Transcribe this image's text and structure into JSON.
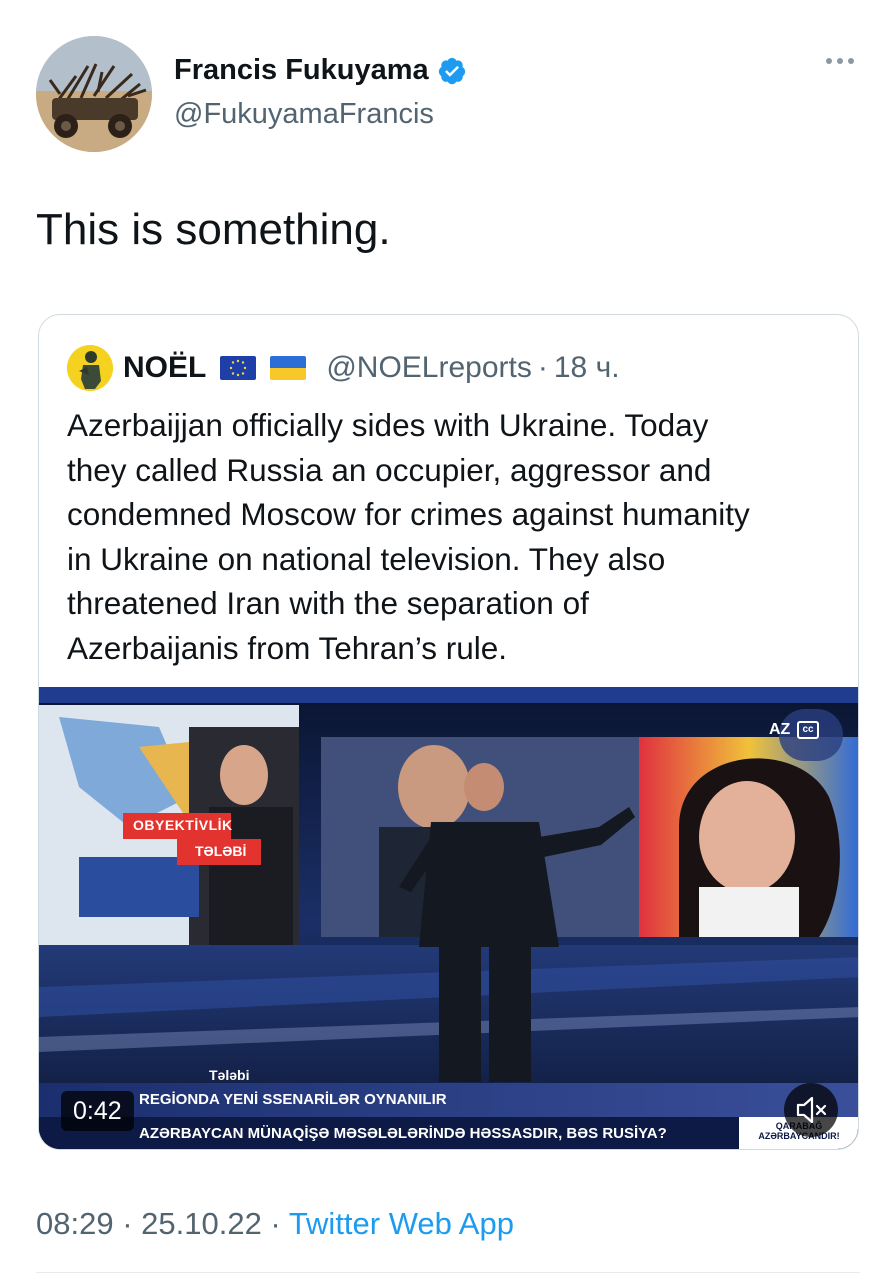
{
  "author": {
    "name": "Francis Fukuyama",
    "handle": "@FukuyamaFrancis",
    "verified": true
  },
  "tweet": {
    "text": "This is something."
  },
  "quoted_tweet": {
    "name": "NOËL",
    "flags": [
      "eu-flag-icon",
      "ukraine-flag-icon"
    ],
    "handle": "@NOELreports",
    "separator": "·",
    "time": "18 ч.",
    "text_lines": [
      "Azerbaijjan officially sides with Ukraine. Today",
      "they called Russia an occupier, aggressor and",
      "condemned Moscow for crimes against humanity",
      "in Ukraine on national television. They also",
      "threatened Iran with the separation of",
      "Azerbaijanis from Tehran’s rule."
    ],
    "video": {
      "duration": "0:42",
      "channel_badge": "AZ",
      "lower_third_line1": "REGİONDA YENİ SSENARİLƏR OYNANILIR",
      "lower_third_line2": "AZƏRBAYCAN MÜNAQİŞƏ MƏSƏLƏLƏRİNDƏ HƏSSASDIR, BƏS RUSİYA?",
      "tag_top": "OBYEKTİVLİK",
      "tag_bottom": "TƏLƏBİ",
      "tag_partial": "Tələbi",
      "corner_logo_line1": "QARABAĞ",
      "corner_logo_line2": "AZƏRBAYCANDIR!",
      "mute_icon": "speaker-muted-icon"
    }
  },
  "footer": {
    "time": "08:29",
    "sep1": " · ",
    "date": "25.10.22",
    "sep2": " · ",
    "source": "Twitter Web App"
  },
  "colors": {
    "link": "#1d9bf0",
    "secondary_text": "#536471",
    "border": "#cfd9de",
    "verified_badge": "#1d9bf0"
  }
}
